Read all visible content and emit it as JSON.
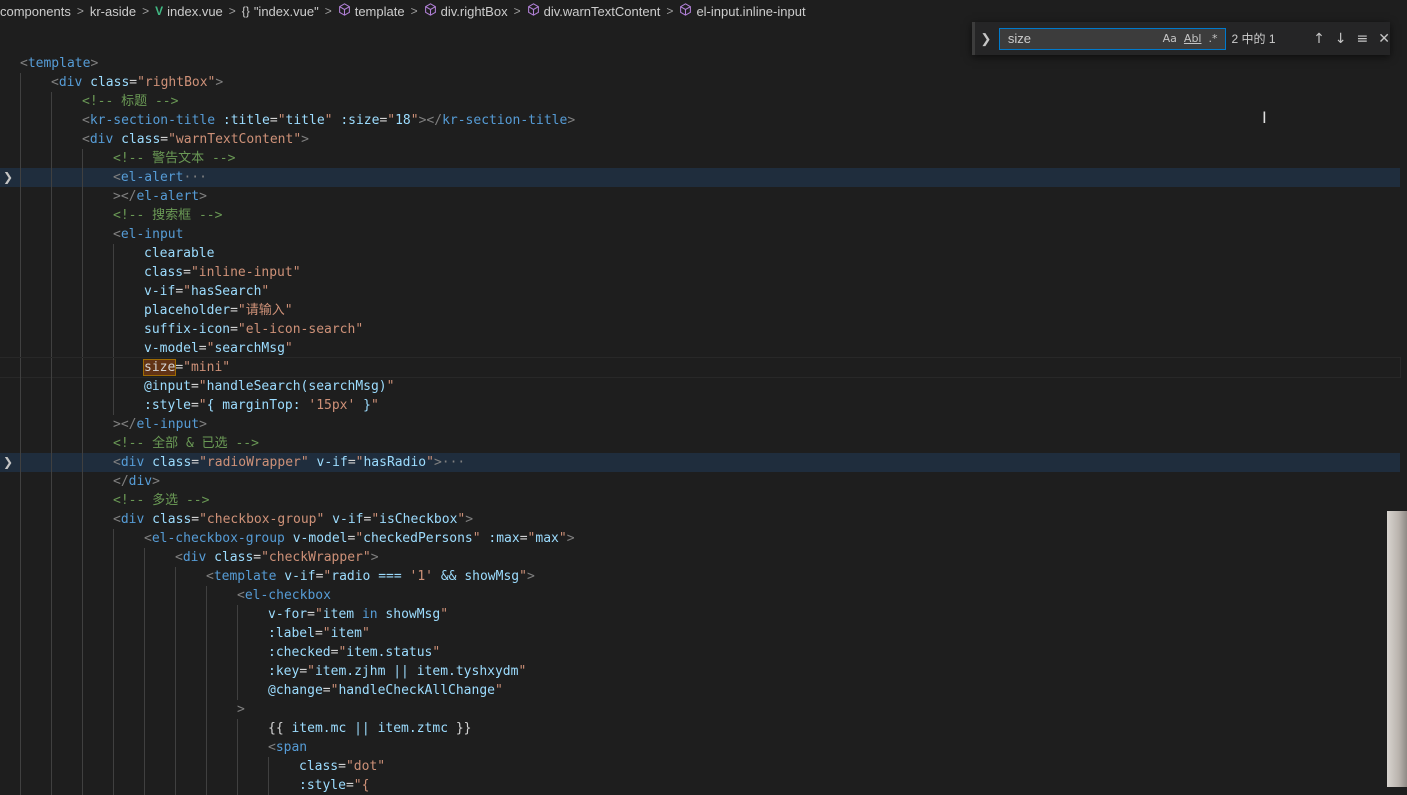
{
  "breadcrumb": [
    {
      "label": "components",
      "icon": ""
    },
    {
      "label": "kr-aside",
      "icon": ""
    },
    {
      "label": "index.vue",
      "icon": "vue-icon"
    },
    {
      "label": "\"index.vue\"",
      "icon": "braces-icon"
    },
    {
      "label": "template",
      "icon": "cube-icon"
    },
    {
      "label": "div.rightBox",
      "icon": "cube-icon"
    },
    {
      "label": "div.warnTextContent",
      "icon": "cube-icon"
    },
    {
      "label": "el-input.inline-input",
      "icon": "cube-icon"
    }
  ],
  "find": {
    "query": "size",
    "match_case_label": "Aa",
    "whole_word_label": "Abl",
    "regex_label": ".*",
    "count_text": "2 中的 1"
  },
  "code": [
    {
      "indent": 0,
      "tokens": [
        [
          "t-punc",
          "<"
        ],
        [
          "t-tag",
          "template"
        ],
        [
          "t-punc",
          ">"
        ]
      ]
    },
    {
      "indent": 1,
      "tokens": [
        [
          "t-punc",
          "<"
        ],
        [
          "t-tag",
          "div"
        ],
        [
          "t-plain",
          " "
        ],
        [
          "t-attr",
          "class"
        ],
        [
          "t-plain",
          "="
        ],
        [
          "t-str",
          "\"rightBox\""
        ],
        [
          "t-punc",
          ">"
        ]
      ]
    },
    {
      "indent": 2,
      "tokens": [
        [
          "t-com",
          "<!-- 标题 -->"
        ]
      ]
    },
    {
      "indent": 2,
      "tokens": [
        [
          "t-punc",
          "<"
        ],
        [
          "t-tag",
          "kr-section-title"
        ],
        [
          "t-plain",
          " "
        ],
        [
          "t-attr",
          ":title"
        ],
        [
          "t-plain",
          "="
        ],
        [
          "t-str",
          "\""
        ],
        [
          "t-attr",
          "title"
        ],
        [
          "t-str",
          "\""
        ],
        [
          "t-plain",
          " "
        ],
        [
          "t-attr",
          ":size"
        ],
        [
          "t-plain",
          "="
        ],
        [
          "t-str",
          "\""
        ],
        [
          "t-attr",
          "18"
        ],
        [
          "t-str",
          "\""
        ],
        [
          "t-punc",
          "></"
        ],
        [
          "t-tag",
          "kr-section-title"
        ],
        [
          "t-punc",
          ">"
        ]
      ]
    },
    {
      "indent": 2,
      "tokens": [
        [
          "t-punc",
          "<"
        ],
        [
          "t-tag",
          "div"
        ],
        [
          "t-plain",
          " "
        ],
        [
          "t-attr",
          "class"
        ],
        [
          "t-plain",
          "="
        ],
        [
          "t-str",
          "\"warnTextContent\""
        ],
        [
          "t-punc",
          ">"
        ]
      ]
    },
    {
      "indent": 3,
      "tokens": [
        [
          "t-com",
          "<!-- 警告文本 -->"
        ]
      ]
    },
    {
      "indent": 3,
      "fold": true,
      "highlight": true,
      "tokens": [
        [
          "t-punc",
          "<"
        ],
        [
          "t-tag",
          "el-alert"
        ],
        [
          "t-punc",
          "···"
        ]
      ]
    },
    {
      "indent": 3,
      "tokens": [
        [
          "t-punc",
          "></"
        ],
        [
          "t-tag",
          "el-alert"
        ],
        [
          "t-punc",
          ">"
        ]
      ]
    },
    {
      "indent": 3,
      "tokens": [
        [
          "t-com",
          "<!-- 搜索框 -->"
        ]
      ]
    },
    {
      "indent": 3,
      "tokens": [
        [
          "t-punc",
          "<"
        ],
        [
          "t-tag",
          "el-input"
        ]
      ]
    },
    {
      "indent": 4,
      "tokens": [
        [
          "t-attr",
          "clearable"
        ]
      ]
    },
    {
      "indent": 4,
      "tokens": [
        [
          "t-attr",
          "class"
        ],
        [
          "t-plain",
          "="
        ],
        [
          "t-str",
          "\"inline-input\""
        ]
      ]
    },
    {
      "indent": 4,
      "tokens": [
        [
          "t-attr",
          "v-if"
        ],
        [
          "t-plain",
          "="
        ],
        [
          "t-str",
          "\""
        ],
        [
          "t-attr",
          "hasSearch"
        ],
        [
          "t-str",
          "\""
        ]
      ]
    },
    {
      "indent": 4,
      "tokens": [
        [
          "t-attr",
          "placeholder"
        ],
        [
          "t-plain",
          "="
        ],
        [
          "t-str",
          "\"请输入\""
        ]
      ]
    },
    {
      "indent": 4,
      "tokens": [
        [
          "t-attr",
          "suffix-icon"
        ],
        [
          "t-plain",
          "="
        ],
        [
          "t-str",
          "\"el-icon-search\""
        ]
      ]
    },
    {
      "indent": 4,
      "tokens": [
        [
          "t-attr",
          "v-model"
        ],
        [
          "t-plain",
          "="
        ],
        [
          "t-str",
          "\""
        ],
        [
          "t-attr",
          "searchMsg"
        ],
        [
          "t-str",
          "\""
        ]
      ]
    },
    {
      "indent": 4,
      "current": true,
      "tokens": [
        [
          "t-match",
          "size"
        ],
        [
          "t-plain",
          "="
        ],
        [
          "t-str",
          "\"mini\""
        ]
      ]
    },
    {
      "indent": 4,
      "tokens": [
        [
          "t-attr",
          "@input"
        ],
        [
          "t-plain",
          "="
        ],
        [
          "t-str",
          "\""
        ],
        [
          "t-attr",
          "handleSearch(searchMsg)"
        ],
        [
          "t-str",
          "\""
        ]
      ]
    },
    {
      "indent": 4,
      "tokens": [
        [
          "t-attr",
          ":style"
        ],
        [
          "t-plain",
          "="
        ],
        [
          "t-str",
          "\""
        ],
        [
          "t-attr",
          "{ marginTop: "
        ],
        [
          "t-str",
          "'15px'"
        ],
        [
          "t-attr",
          " }"
        ],
        [
          "t-str",
          "\""
        ]
      ]
    },
    {
      "indent": 3,
      "tokens": [
        [
          "t-punc",
          "></"
        ],
        [
          "t-tag",
          "el-input"
        ],
        [
          "t-punc",
          ">"
        ]
      ]
    },
    {
      "indent": 3,
      "tokens": [
        [
          "t-com",
          "<!-- 全部 & 已选 -->"
        ]
      ]
    },
    {
      "indent": 3,
      "fold": true,
      "highlight": true,
      "tokens": [
        [
          "t-punc",
          "<"
        ],
        [
          "t-tag",
          "div"
        ],
        [
          "t-plain",
          " "
        ],
        [
          "t-attr",
          "class"
        ],
        [
          "t-plain",
          "="
        ],
        [
          "t-str",
          "\"radioWrapper\""
        ],
        [
          "t-plain",
          " "
        ],
        [
          "t-attr",
          "v-if"
        ],
        [
          "t-plain",
          "="
        ],
        [
          "t-str",
          "\""
        ],
        [
          "t-attr",
          "hasRadio"
        ],
        [
          "t-str",
          "\""
        ],
        [
          "t-punc",
          ">···"
        ]
      ]
    },
    {
      "indent": 3,
      "tokens": [
        [
          "t-punc",
          "</"
        ],
        [
          "t-tag",
          "div"
        ],
        [
          "t-punc",
          ">"
        ]
      ]
    },
    {
      "indent": 3,
      "tokens": [
        [
          "t-com",
          "<!-- 多选 -->"
        ]
      ]
    },
    {
      "indent": 3,
      "tokens": [
        [
          "t-punc",
          "<"
        ],
        [
          "t-tag",
          "div"
        ],
        [
          "t-plain",
          " "
        ],
        [
          "t-attr",
          "class"
        ],
        [
          "t-plain",
          "="
        ],
        [
          "t-str",
          "\"checkbox-group\""
        ],
        [
          "t-plain",
          " "
        ],
        [
          "t-attr",
          "v-if"
        ],
        [
          "t-plain",
          "="
        ],
        [
          "t-str",
          "\""
        ],
        [
          "t-attr",
          "isCheckbox"
        ],
        [
          "t-str",
          "\""
        ],
        [
          "t-punc",
          ">"
        ]
      ]
    },
    {
      "indent": 4,
      "tokens": [
        [
          "t-punc",
          "<"
        ],
        [
          "t-tag",
          "el-checkbox-group"
        ],
        [
          "t-plain",
          " "
        ],
        [
          "t-attr",
          "v-model"
        ],
        [
          "t-plain",
          "="
        ],
        [
          "t-str",
          "\""
        ],
        [
          "t-attr",
          "checkedPersons"
        ],
        [
          "t-str",
          "\""
        ],
        [
          "t-plain",
          " "
        ],
        [
          "t-attr",
          ":max"
        ],
        [
          "t-plain",
          "="
        ],
        [
          "t-str",
          "\""
        ],
        [
          "t-attr",
          "max"
        ],
        [
          "t-str",
          "\""
        ],
        [
          "t-punc",
          ">"
        ]
      ]
    },
    {
      "indent": 5,
      "tokens": [
        [
          "t-punc",
          "<"
        ],
        [
          "t-tag",
          "div"
        ],
        [
          "t-plain",
          " "
        ],
        [
          "t-attr",
          "class"
        ],
        [
          "t-plain",
          "="
        ],
        [
          "t-str",
          "\"checkWrapper\""
        ],
        [
          "t-punc",
          ">"
        ]
      ]
    },
    {
      "indent": 6,
      "tokens": [
        [
          "t-punc",
          "<"
        ],
        [
          "t-tag",
          "template"
        ],
        [
          "t-plain",
          " "
        ],
        [
          "t-attr",
          "v-if"
        ],
        [
          "t-plain",
          "="
        ],
        [
          "t-str",
          "\""
        ],
        [
          "t-attr",
          "radio === "
        ],
        [
          "t-str",
          "'1'"
        ],
        [
          "t-attr",
          " && showMsg"
        ],
        [
          "t-str",
          "\""
        ],
        [
          "t-punc",
          ">"
        ]
      ]
    },
    {
      "indent": 7,
      "tokens": [
        [
          "t-punc",
          "<"
        ],
        [
          "t-tag",
          "el-checkbox"
        ]
      ]
    },
    {
      "indent": 8,
      "tokens": [
        [
          "t-attr",
          "v-for"
        ],
        [
          "t-plain",
          "="
        ],
        [
          "t-str",
          "\""
        ],
        [
          "t-attr",
          "item "
        ],
        [
          "t-kw",
          "in"
        ],
        [
          "t-attr",
          " showMsg"
        ],
        [
          "t-str",
          "\""
        ]
      ]
    },
    {
      "indent": 8,
      "tokens": [
        [
          "t-attr",
          ":label"
        ],
        [
          "t-plain",
          "="
        ],
        [
          "t-str",
          "\""
        ],
        [
          "t-attr",
          "item"
        ],
        [
          "t-str",
          "\""
        ]
      ]
    },
    {
      "indent": 8,
      "tokens": [
        [
          "t-attr",
          ":checked"
        ],
        [
          "t-plain",
          "="
        ],
        [
          "t-str",
          "\""
        ],
        [
          "t-attr",
          "item.status"
        ],
        [
          "t-str",
          "\""
        ]
      ]
    },
    {
      "indent": 8,
      "tokens": [
        [
          "t-attr",
          ":key"
        ],
        [
          "t-plain",
          "="
        ],
        [
          "t-str",
          "\""
        ],
        [
          "t-attr",
          "item.zjhm || item.tyshxydm"
        ],
        [
          "t-str",
          "\""
        ]
      ]
    },
    {
      "indent": 8,
      "tokens": [
        [
          "t-attr",
          "@change"
        ],
        [
          "t-plain",
          "="
        ],
        [
          "t-str",
          "\""
        ],
        [
          "t-attr",
          "handleCheckAllChange"
        ],
        [
          "t-str",
          "\""
        ]
      ]
    },
    {
      "indent": 7,
      "tokens": [
        [
          "t-punc",
          ">"
        ]
      ]
    },
    {
      "indent": 8,
      "tokens": [
        [
          "t-plain",
          "{{ "
        ],
        [
          "t-attr",
          "item.mc || item.ztmc"
        ],
        [
          "t-plain",
          " }}"
        ]
      ]
    },
    {
      "indent": 8,
      "tokens": [
        [
          "t-punc",
          "<"
        ],
        [
          "t-tag",
          "span"
        ]
      ]
    },
    {
      "indent": 9,
      "tokens": [
        [
          "t-attr",
          "class"
        ],
        [
          "t-plain",
          "="
        ],
        [
          "t-str",
          "\"dot\""
        ]
      ]
    },
    {
      "indent": 9,
      "tokens": [
        [
          "t-attr",
          ":style"
        ],
        [
          "t-plain",
          "="
        ],
        [
          "t-str",
          "\"{"
        ]
      ]
    }
  ]
}
